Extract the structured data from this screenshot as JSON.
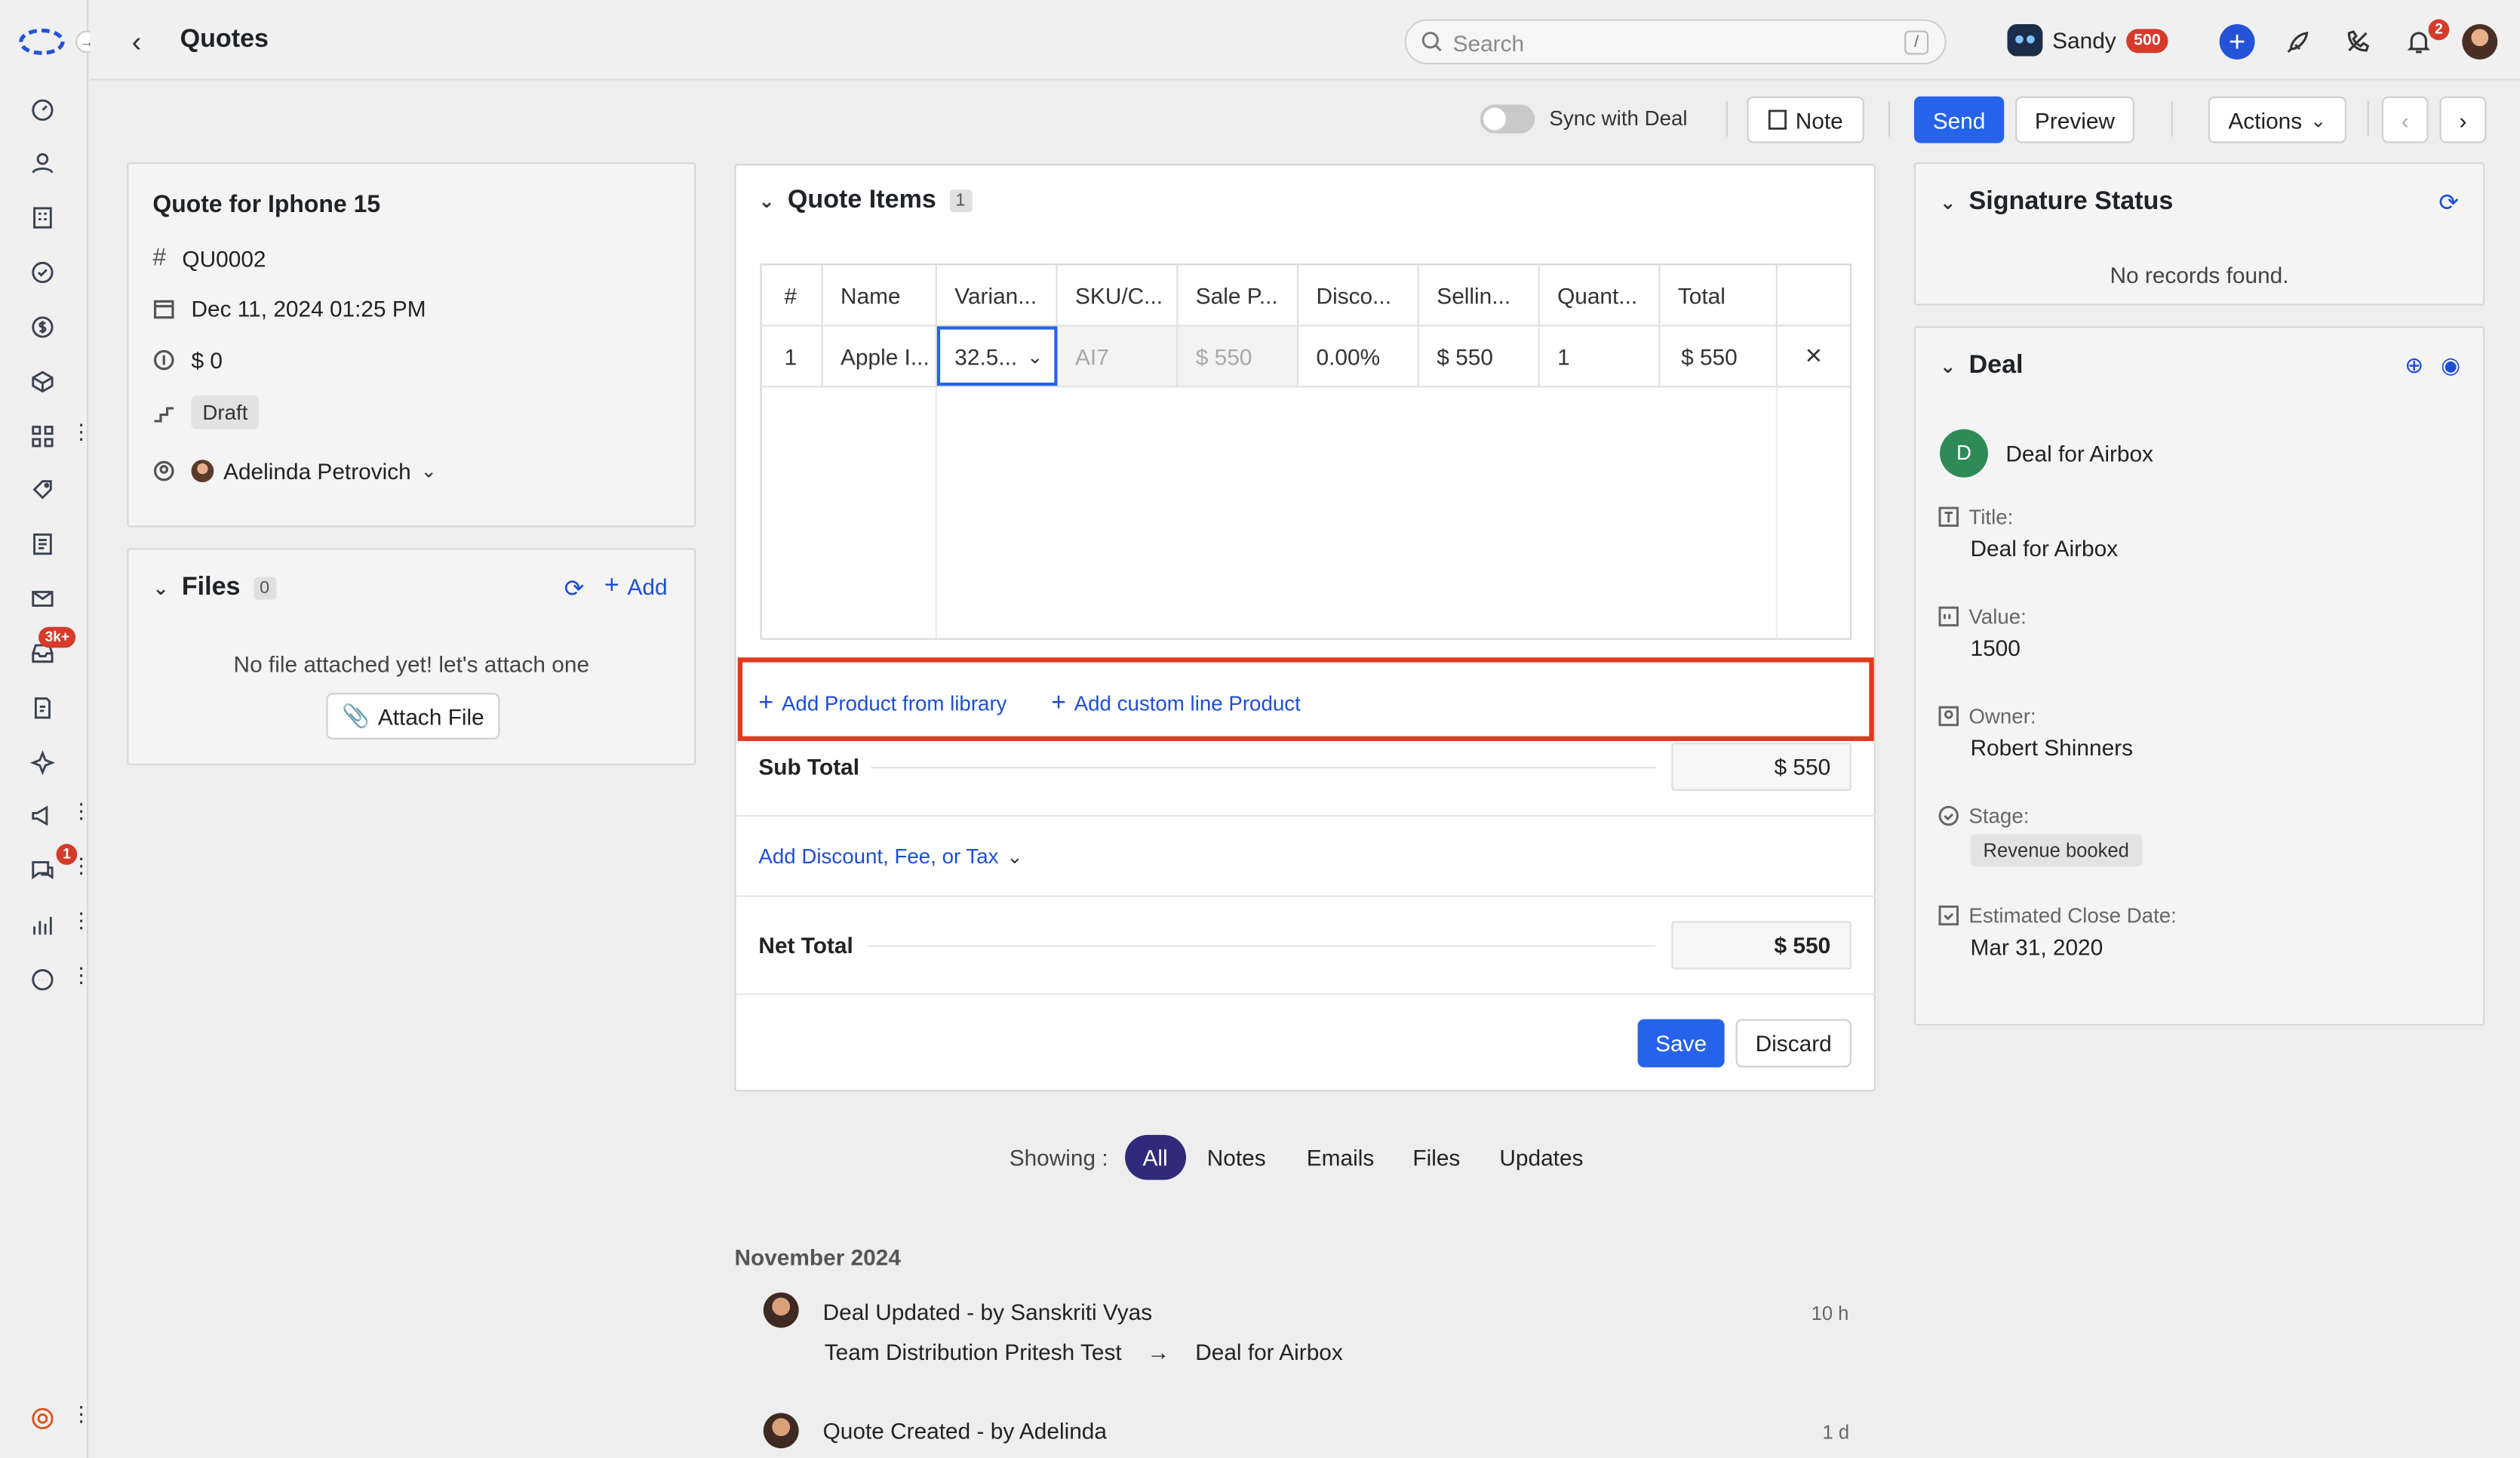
{
  "header": {
    "title": "Quotes",
    "search_placeholder": "Search",
    "search_shortcut": "/",
    "user_name": "Sandy",
    "credits": "500",
    "notifications_count": "2"
  },
  "sidebar": {
    "inbox_badge": "3k+",
    "chat_badge": "1",
    "items": [
      "dashboard-icon",
      "contacts-icon",
      "accounts-icon",
      "tasks-icon",
      "deals-icon",
      "products-icon",
      "apps-icon",
      "tags-icon",
      "documents-icon",
      "email-icon",
      "inbox-icon",
      "forms-icon",
      "sparkle-icon",
      "campaign-icon",
      "chat-icon",
      "reports-icon",
      "more-icon"
    ]
  },
  "toolbar": {
    "sync_label": "Sync with Deal",
    "note_label": "Note",
    "send_label": "Send",
    "preview_label": "Preview",
    "actions_label": "Actions"
  },
  "quote_summary": {
    "title": "Quote for Iphone 15",
    "number": "QU0002",
    "date": "Dec 11, 2024 01:25 PM",
    "amount": "$ 0",
    "status": "Draft",
    "owner": "Adelinda Petrovich"
  },
  "files": {
    "title": "Files",
    "count": "0",
    "add_label": "Add",
    "empty_text": "No file attached yet! let's attach one",
    "attach_label": "Attach File"
  },
  "quote_items": {
    "title": "Quote Items",
    "count": "1",
    "columns": [
      "#",
      "Name",
      "Varian...",
      "SKU/C...",
      "Sale P...",
      "Disco...",
      "Sellin...",
      "Quant...",
      "Total",
      ""
    ],
    "rows": [
      {
        "num": "1",
        "name": "Apple I...",
        "variant": "32.5...",
        "sku": "AI7",
        "sale_price": "$ 550",
        "discount": "0.00%",
        "selling": "$ 550",
        "quantity": "1",
        "total": "$ 550"
      }
    ],
    "add_library_label": "Add Product from library",
    "add_custom_label": "Add custom line Product",
    "subtotal_label": "Sub Total",
    "subtotal_value": "$ 550",
    "discount_link": "Add Discount, Fee, or Tax",
    "net_total_label": "Net Total",
    "net_total_value": "$ 550",
    "save_label": "Save",
    "discard_label": "Discard"
  },
  "activity": {
    "showing_label": "Showing :",
    "filters": [
      "All",
      "Notes",
      "Emails",
      "Files",
      "Updates"
    ],
    "month": "November 2024",
    "items": [
      {
        "title": "Deal Updated",
        "by": " - by Sanskriti Vyas",
        "time": "10 h",
        "from": "Team Distribution Pritesh Test",
        "arrow": "→",
        "to": "Deal for Airbox"
      },
      {
        "title": "Quote Created",
        "by": " - by Adelinda",
        "time": "1 d"
      }
    ]
  },
  "signature": {
    "title": "Signature Status",
    "empty_text": "No records found."
  },
  "deal": {
    "title": "Deal",
    "avatar_letter": "D",
    "name": "Deal for Airbox",
    "title_label": "Title:",
    "title_value": "Deal for Airbox",
    "value_label": "Value:",
    "value_value": "1500",
    "owner_label": "Owner:",
    "owner_value": "Robert Shinners",
    "stage_label": "Stage:",
    "stage_value": "Revenue booked",
    "close_label": "Estimated Close Date:",
    "close_value": "Mar 31, 2020"
  },
  "colors": {
    "primary": "#2563eb",
    "highlight": "#e03a1e",
    "active_filter": "#2f2a7a",
    "deal_avatar": "#2e8b57",
    "badge": "#d63a2a"
  }
}
